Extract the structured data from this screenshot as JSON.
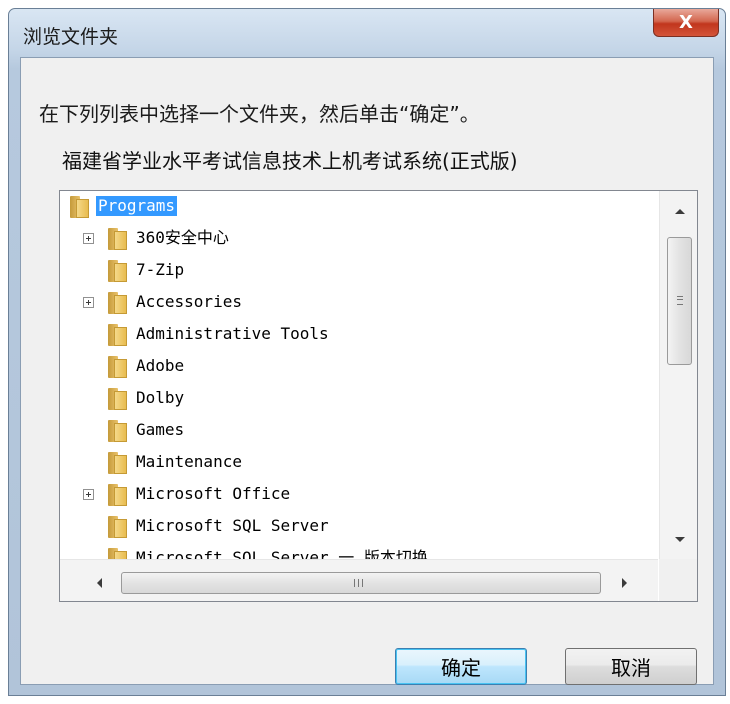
{
  "window": {
    "title": "浏览文件夹",
    "close_label": "X"
  },
  "instruction": "在下列列表中选择一个文件夹，然后单击“确定”。",
  "selected_path": "福建省学业水平考试信息技术上机考试系统(正式版)",
  "tree": {
    "root": {
      "label": "Programs",
      "selected": true
    },
    "items": [
      {
        "label": "360安全中心",
        "expandable": true
      },
      {
        "label": "7-Zip",
        "expandable": false
      },
      {
        "label": "Accessories",
        "expandable": true
      },
      {
        "label": "Administrative Tools",
        "expandable": false
      },
      {
        "label": "Adobe",
        "expandable": false
      },
      {
        "label": "Dolby",
        "expandable": false
      },
      {
        "label": "Games",
        "expandable": false
      },
      {
        "label": "Maintenance",
        "expandable": false
      },
      {
        "label": "Microsoft Office",
        "expandable": true
      },
      {
        "label": "Microsoft SQL Server",
        "expandable": false
      },
      {
        "label": "Microsoft SQL Server 一 版本切换",
        "expandable": false
      }
    ]
  },
  "buttons": {
    "ok": "确定",
    "cancel": "取消"
  },
  "icons": {
    "folder": "folder-icon",
    "expand": "plus-box-icon",
    "close": "close-icon"
  },
  "colors": {
    "selection": "#3399ff",
    "close_button": "#c1361d"
  }
}
